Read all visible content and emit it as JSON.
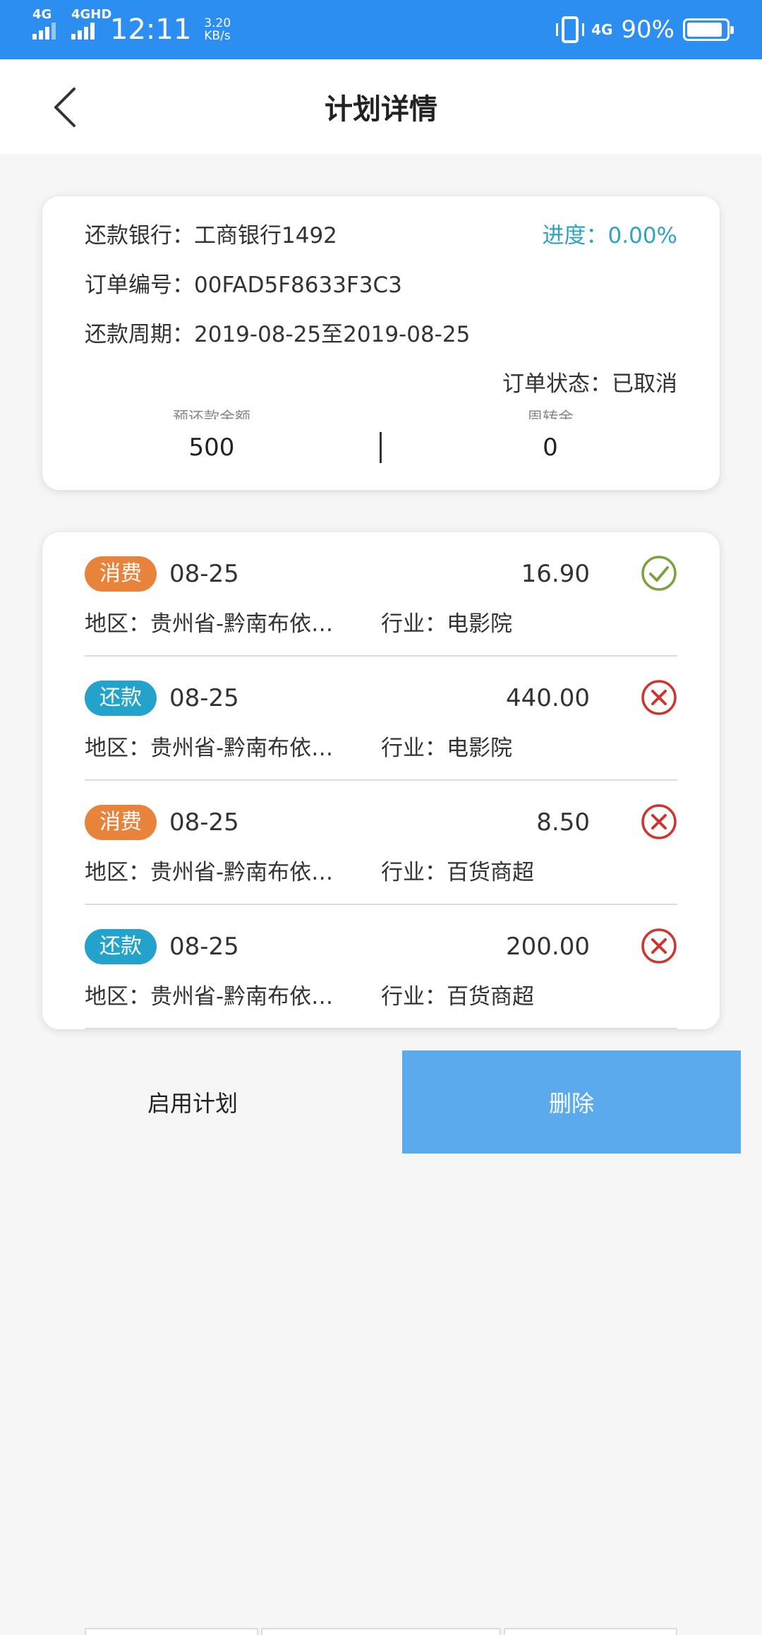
{
  "status_bar": {
    "net1": "4G",
    "net2": "4GHD",
    "time": "12:11",
    "speed_value": "3.20",
    "speed_unit": "KB/s",
    "net3": "4G",
    "battery": "90%",
    "battery_level": 0.9
  },
  "header": {
    "title": "计划详情",
    "back_icon": "chevron-left-icon"
  },
  "summary": {
    "bank": "还款银行：工商银行1492",
    "progress": "进度：0.00%",
    "order_no": "订单编号：00FAD5F8633F3C3",
    "period": "还款周期：2019-08-25至2019-08-25",
    "order_status": "订单状态：已取消",
    "col1_label": "预还款金额",
    "col1_value": "500",
    "col2_label": "周转金",
    "col2_value": "0"
  },
  "records": [
    {
      "tag": "消费",
      "type": "consume",
      "date": "08-25",
      "amount": "16.90",
      "status": "success",
      "region": "地区：贵州省-黔南布依…",
      "industry": "行业：电影院"
    },
    {
      "tag": "还款",
      "type": "repay",
      "date": "08-25",
      "amount": "440.00",
      "status": "failed",
      "region": "地区：贵州省-黔南布依…",
      "industry": "行业：电影院"
    },
    {
      "tag": "消费",
      "type": "consume",
      "date": "08-25",
      "amount": "8.50",
      "status": "failed",
      "region": "地区：贵州省-黔南布依…",
      "industry": "行业：百货商超"
    },
    {
      "tag": "还款",
      "type": "repay",
      "date": "08-25",
      "amount": "200.00",
      "status": "failed",
      "region": "地区：贵州省-黔南布依…",
      "industry": "行业：百货商超"
    }
  ],
  "actions": {
    "enable": "启用计划",
    "delete": "删除"
  },
  "colors": {
    "status_bar": "#2b8ef0",
    "progress": "#2fa3c6",
    "consume_tag": "#e8833c",
    "repay_tag": "#23a3cc",
    "success": "#7ba23f",
    "failed": "#d0342c",
    "delete_button": "#5baaec"
  }
}
